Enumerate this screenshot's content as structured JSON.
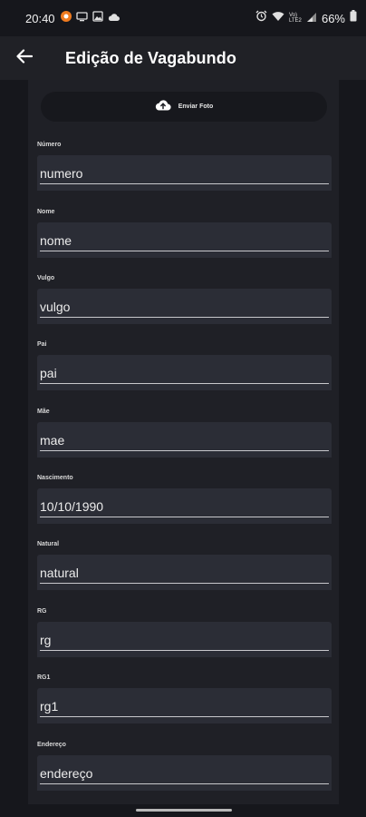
{
  "status_bar": {
    "time": "20:40",
    "battery_pct": "66%",
    "network_label": "Vo) LTE2",
    "icons_left": [
      "notification-icon",
      "cast-icon",
      "image-icon",
      "cloud-icon"
    ],
    "icons_right": [
      "alarm-icon",
      "wifi-icon",
      "signal-icon",
      "battery-icon"
    ]
  },
  "app_bar": {
    "title": "Edição de Vagabundo",
    "back_icon": "arrow-left-icon"
  },
  "photo_button": {
    "label": "Enviar Foto",
    "icon": "cloud-upload-icon"
  },
  "fields": [
    {
      "label": "Número",
      "value": "numero"
    },
    {
      "label": "Nome",
      "value": "nome"
    },
    {
      "label": "Vulgo",
      "value": "vulgo"
    },
    {
      "label": "Pai",
      "value": "pai"
    },
    {
      "label": "Mãe",
      "value": "mae"
    },
    {
      "label": "Nascimento",
      "value": "10/10/1990"
    },
    {
      "label": "Natural",
      "value": "natural"
    },
    {
      "label": "RG",
      "value": "rg"
    },
    {
      "label": "RG1",
      "value": "rg1"
    },
    {
      "label": "Endereço",
      "value": "endereço"
    }
  ],
  "colors": {
    "background": "#16171c",
    "app_bar": "#202126",
    "panel": "#1f2026",
    "input": "#2b2d36"
  }
}
